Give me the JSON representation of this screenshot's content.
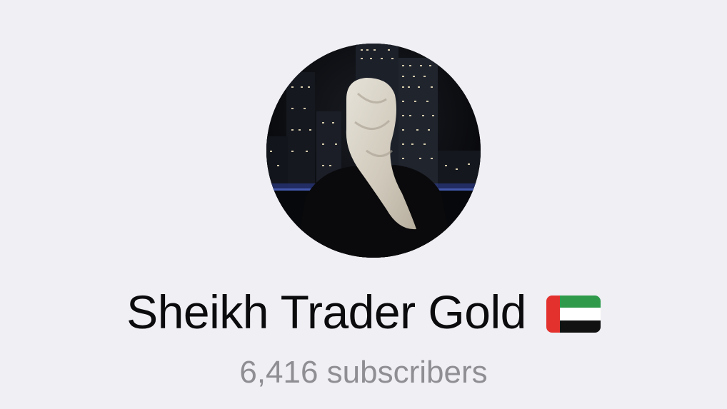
{
  "profile": {
    "avatar_icon": "channel-avatar-photo",
    "name": "Sheikh Trader Gold",
    "flag_icon": "uae-flag-icon",
    "subscribers": "6,416 subscribers"
  },
  "colors": {
    "background": "#efeff4",
    "title": "#0b0b0d",
    "subtitle": "#8e8e93",
    "flag_green": "#2e9a4a",
    "flag_white": "#ffffff",
    "flag_black": "#111111",
    "flag_red": "#e3322e"
  }
}
